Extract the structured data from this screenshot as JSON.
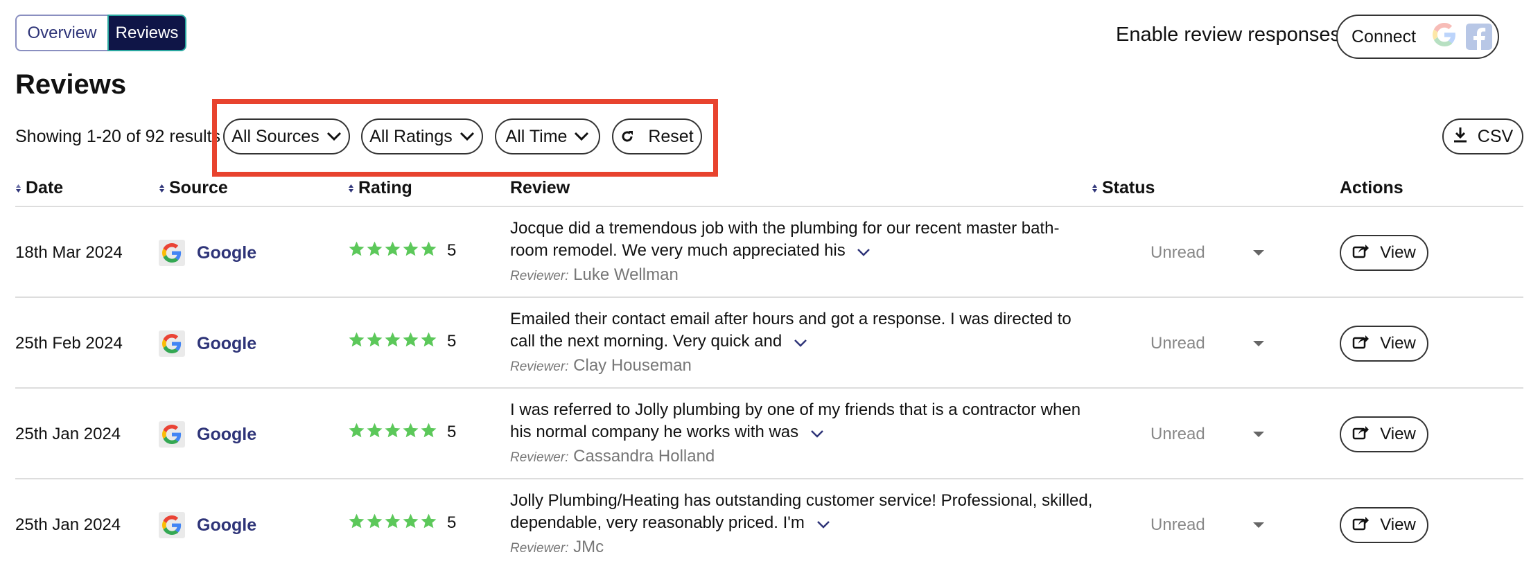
{
  "tabs": {
    "overview": "Overview",
    "reviews": "Reviews"
  },
  "header": {
    "enable_label": "Enable review responses:",
    "connect_label": "Connect"
  },
  "page_title": "Reviews",
  "showing": "Showing 1-20 of 92 results",
  "filters": {
    "sources": "All Sources",
    "ratings": "All Ratings",
    "time": "All Time",
    "reset": "Reset"
  },
  "csv_label": "CSV",
  "columns": {
    "date": "Date",
    "source": "Source",
    "rating": "Rating",
    "review": "Review",
    "status": "Status",
    "actions": "Actions"
  },
  "reviewer_prefix": "Reviewer:",
  "view_label": "View",
  "colors": {
    "star": "#5cc85a",
    "brand_dark": "#0f1547",
    "highlight": "#e8432e"
  },
  "rows": [
    {
      "date": "18th Mar 2024",
      "source": "Google",
      "rating": "5",
      "review_line1": "Jocque did a tremendous job with the plumbing for our recent master bath-",
      "review_line2": "room remodel. We very much appreciated his",
      "reviewer": "Luke Wellman",
      "status": "Unread"
    },
    {
      "date": "25th Feb 2024",
      "source": "Google",
      "rating": "5",
      "review_line1": "Emailed their contact email after hours and got a response. I was directed to",
      "review_line2": "call the next morning. Very quick and",
      "reviewer": "Clay Houseman",
      "status": "Unread"
    },
    {
      "date": "25th Jan 2024",
      "source": "Google",
      "rating": "5",
      "review_line1": "I was referred to Jolly plumbing by one of my friends that is a contractor when",
      "review_line2": "his normal company he works with was",
      "reviewer": "Cassandra Holland",
      "status": "Unread"
    },
    {
      "date": "25th Jan 2024",
      "source": "Google",
      "rating": "5",
      "review_line1": "Jolly Plumbing/Heating has outstanding customer service! Professional, skilled,",
      "review_line2": "dependable, very reasonably priced. I'm",
      "reviewer": "JMc",
      "status": "Unread"
    }
  ]
}
